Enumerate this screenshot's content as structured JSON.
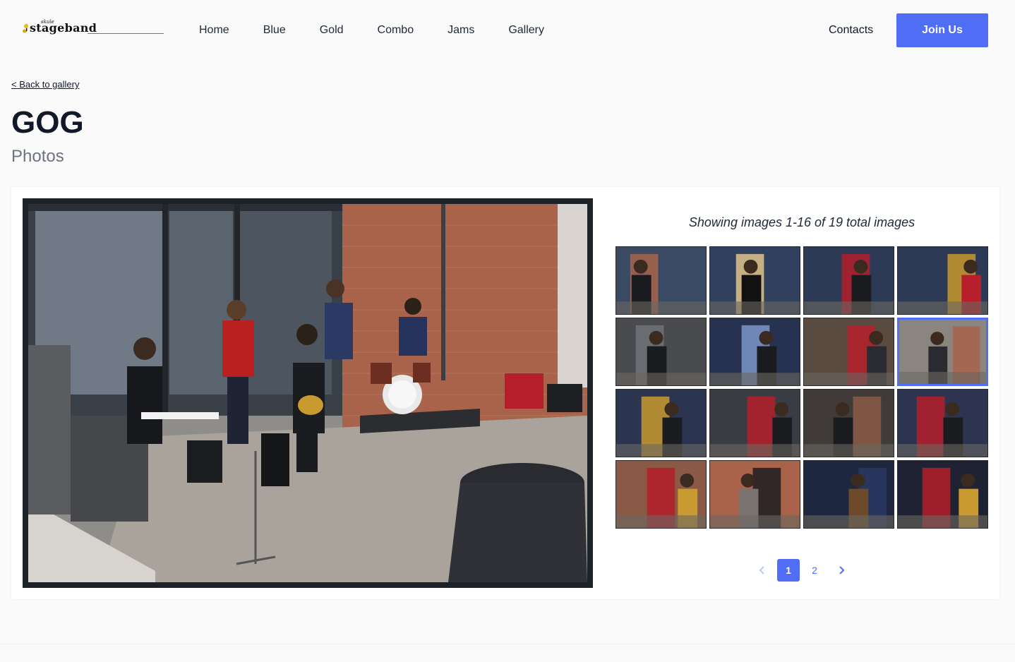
{
  "header": {
    "logo_text": "stageband",
    "logo_small": "skule",
    "nav": [
      "Home",
      "Blue",
      "Gold",
      "Combo",
      "Jams",
      "Gallery"
    ],
    "contacts_label": "Contacts",
    "join_label": "Join Us"
  },
  "page": {
    "back_link": "< Back to gallery",
    "title": "GOG",
    "subtitle": "Photos"
  },
  "gallery": {
    "showing_text": "Showing images 1-16 of 19 total images",
    "thumbnail_count": 16,
    "selected_index": 7
  },
  "pagination": {
    "prev_icon": "chevron-left-icon",
    "pages": [
      "1",
      "2"
    ],
    "current_page": "1",
    "next_icon": "chevron-right-icon"
  },
  "colors": {
    "accent": "#4f6df5",
    "photo_frame": "#1d2128"
  }
}
